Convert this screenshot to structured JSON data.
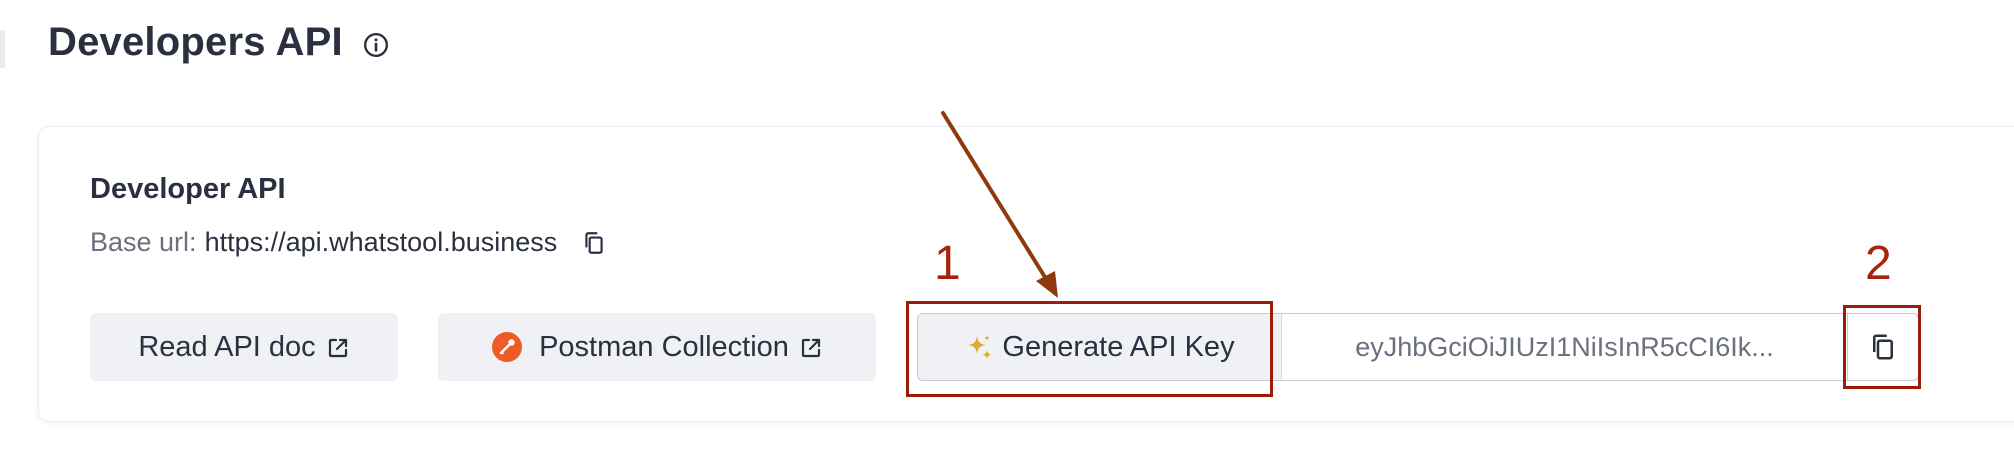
{
  "header": {
    "title": "Developers API",
    "info_icon": "info-circle-icon"
  },
  "card": {
    "title": "Developer API",
    "base_url_label": "Base url:",
    "base_url_value": "https://api.whatstool.business",
    "copy_icon": "copy-icon"
  },
  "actions": {
    "read_api_doc": "Read API doc",
    "postman_collection": "Postman Collection",
    "generate_api_key": "Generate API Key",
    "external_link_icon": "external-link-icon",
    "postman_logo_icon": "postman-logo-icon",
    "sparkle_icon": "sparkle-icon"
  },
  "api_key": {
    "value": "eyJhbGciOiJIUzI1NiIsInR5cCI6Ik..."
  },
  "annotations": {
    "label_1": "1",
    "label_2": "2"
  },
  "colors": {
    "annotation": "#9c1c0c",
    "postman_orange": "#ef5b25",
    "sparkle_gold": "#e0a92a",
    "text_primary": "#2b3040",
    "text_muted": "#6b7080",
    "button_bg": "#f0f1f5"
  }
}
